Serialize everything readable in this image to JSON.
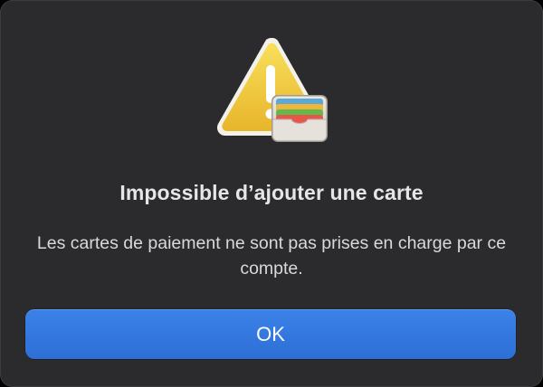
{
  "dialog": {
    "icon": "warning-triangle-with-wallet-icon",
    "title": "Impossible d’ajouter une carte",
    "message": "Les cartes de paiement ne sont pas prises en charge par ce compte.",
    "ok_label": "OK"
  },
  "colors": {
    "background": "#2b2b2d",
    "accent": "#3478e4",
    "warning": "#f3c531"
  }
}
